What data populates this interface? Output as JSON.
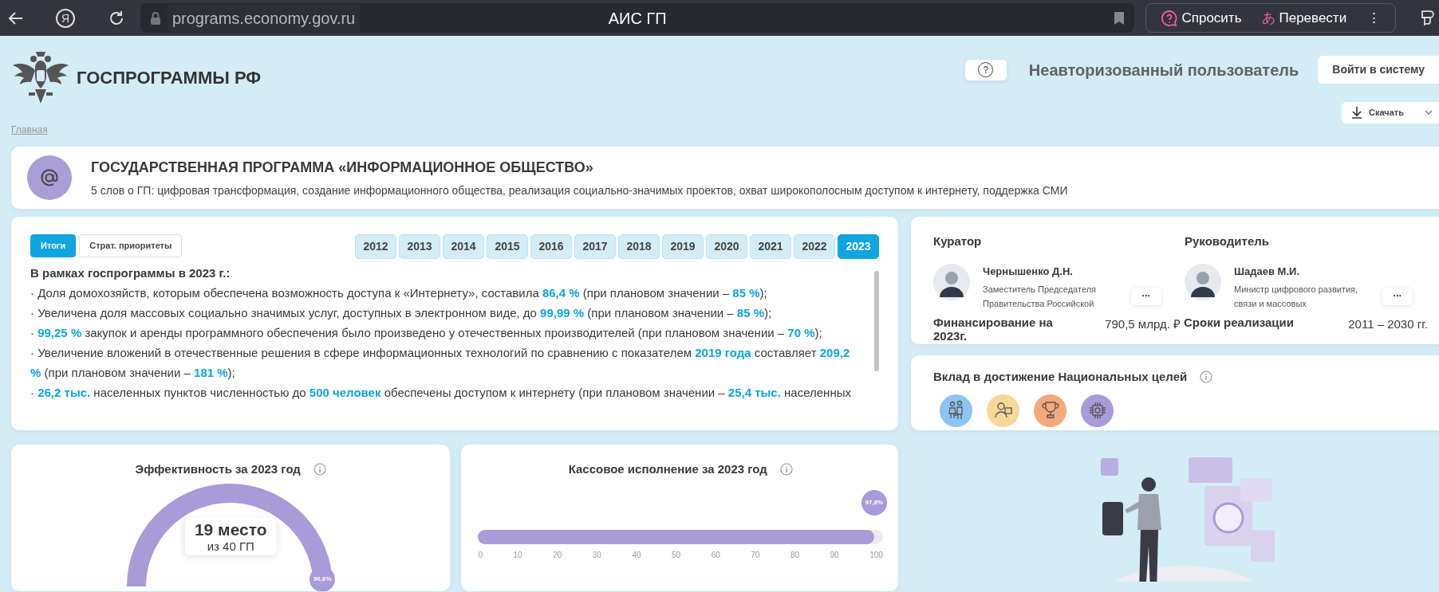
{
  "browser": {
    "logo_letter": "Я",
    "address": "programs.economy.gov.ru",
    "title": "АИС ГП",
    "ask": "Спросить",
    "translate_glyph": "あ",
    "translate": "Перевести",
    "menu_glyph": "⋮"
  },
  "header": {
    "brand": "ГОСПРОГРАММЫ РФ",
    "help_glyph": "?",
    "user": "Неавторизованный пользователь",
    "login": "Войти в систему",
    "breadcrumb": "Главная",
    "download": "Скачать"
  },
  "program": {
    "title": "ГОСУДАРСТВЕННАЯ ПРОГРАММА «ИНФОРМАЦИОННОЕ ОБЩЕСТВО»",
    "summary": "5 слов о ГП: цифровая трансформация, создание информационного общества, реализация социально-значимых проектов, охват широкополосным доступом к интернету, поддержка СМИ"
  },
  "results": {
    "tabs": [
      {
        "label": "Итоги",
        "selected": true
      },
      {
        "label": "Страт. приоритеты",
        "selected": false
      }
    ],
    "years": [
      {
        "label": "2012",
        "selected": false
      },
      {
        "label": "2013",
        "selected": false
      },
      {
        "label": "2014",
        "selected": false
      },
      {
        "label": "2015",
        "selected": false
      },
      {
        "label": "2016",
        "selected": false
      },
      {
        "label": "2017",
        "selected": false
      },
      {
        "label": "2018",
        "selected": false
      },
      {
        "label": "2019",
        "selected": false
      },
      {
        "label": "2020",
        "selected": false
      },
      {
        "label": "2021",
        "selected": false
      },
      {
        "label": "2022",
        "selected": false
      },
      {
        "label": "2023",
        "selected": true
      }
    ],
    "heading": "В рамках госпрограммы в 2023 г.:",
    "items": [
      "· Доля домохозяйств, которым обеспечена возможность доступа к «Интернету», составила **86,4 %** (при плановом значении – **85 %**);",
      "· Увеличена доля массовых социально значимых услуг, доступных в электронном виде, до **99,99 %** (при плановом значении – **85 %**);",
      "· **99,25 %** закупок и аренды программного обеспечения было произведено у отечественных производителей (при плановом значении – **70 %**);",
      "· Увеличение вложений в отечественные решения в сфере информационных технологий по сравнению с показателем **2019 года** составляет **209,2 %** (при плановом значении – **181 %**);",
      "· **26,2 тыс.** населенных пунктов численностью до **500 человек** обеспечены доступом к интернету (при плановом значении – **25,4 тыс.** населенных"
    ]
  },
  "people": [
    {
      "role": "Куратор",
      "name": "Чернышенко Д.Н.",
      "position": "Заместитель Председателя Правительства Российской",
      "more": "···"
    },
    {
      "role": "Руководитель",
      "name": "Шадаев М.И.",
      "position": "Министр цифрового развития, связи и массовых",
      "more": "···"
    }
  ],
  "facts": [
    {
      "label": "Финансирование на 2023г.",
      "value": "790,5 млрд. ₽"
    },
    {
      "label": "Сроки реализации",
      "value": "2011 – 2030 гг."
    }
  ],
  "goals": {
    "title": "Вклад в достижение Национальных целей",
    "items": [
      {
        "kind": "family",
        "color": "#8ec3f5"
      },
      {
        "kind": "person",
        "color": "#f8d897"
      },
      {
        "kind": "trophy",
        "color": "#f4a97a"
      },
      {
        "kind": "chip",
        "color": "#a99bd8"
      }
    ]
  },
  "efficiency": {
    "title": "Эффективность за 2023 год",
    "rank": "19 место",
    "of": "из 40 ГП",
    "level": 0.966,
    "reading": "96,6%"
  },
  "cash": {
    "title": "Кассовое исполнение за 2023 год",
    "level": 0.978,
    "reading": "97,8%",
    "ticks": [
      "0",
      "10",
      "20",
      "30",
      "40",
      "50",
      "60",
      "70",
      "80",
      "90",
      "100"
    ]
  }
}
